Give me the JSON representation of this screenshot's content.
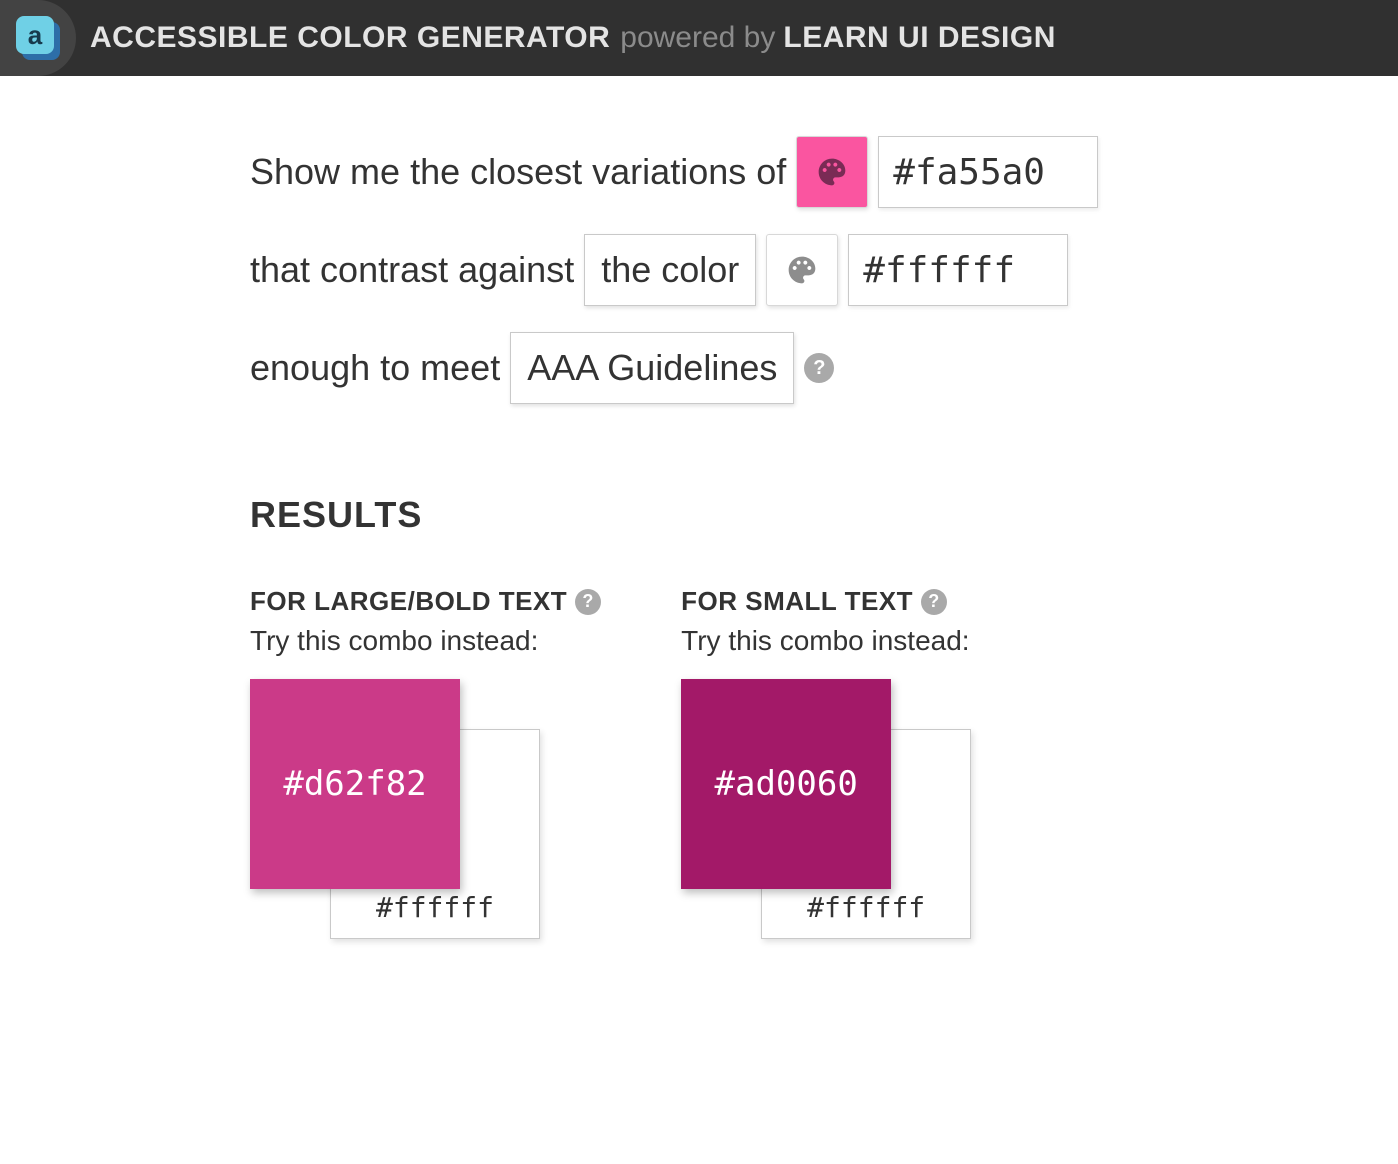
{
  "header": {
    "logo_letter": "a",
    "title": "ACCESSIBLE COLOR GENERATOR",
    "powered_by": "powered by",
    "brand": "LEARN UI DESIGN"
  },
  "form": {
    "text1": "Show me the closest variations of",
    "source_color": "#fa55a0",
    "source_hex": "#fa55a0",
    "text2": "that contrast against",
    "bg_select": "the color",
    "bg_color": "#ffffff",
    "bg_hex": "#ffffff",
    "text3": "enough to meet",
    "guideline_select": "AAA Guidelines",
    "palette_icon_dark": "#7a2b55",
    "palette_icon_grey": "#8d8d8d"
  },
  "results": {
    "heading": "RESULTS",
    "large": {
      "title": "FOR LARGE/BOLD TEXT",
      "subtitle": "Try this combo instead:",
      "front_hex": "#d62f82",
      "front_color": "#cb3a88",
      "back_hex": "#ffffff",
      "back_color": "#ffffff"
    },
    "small": {
      "title": "FOR SMALL TEXT",
      "subtitle": "Try this combo instead:",
      "front_hex": "#ad0060",
      "front_color": "#a31968",
      "back_hex": "#ffffff",
      "back_color": "#ffffff"
    }
  }
}
